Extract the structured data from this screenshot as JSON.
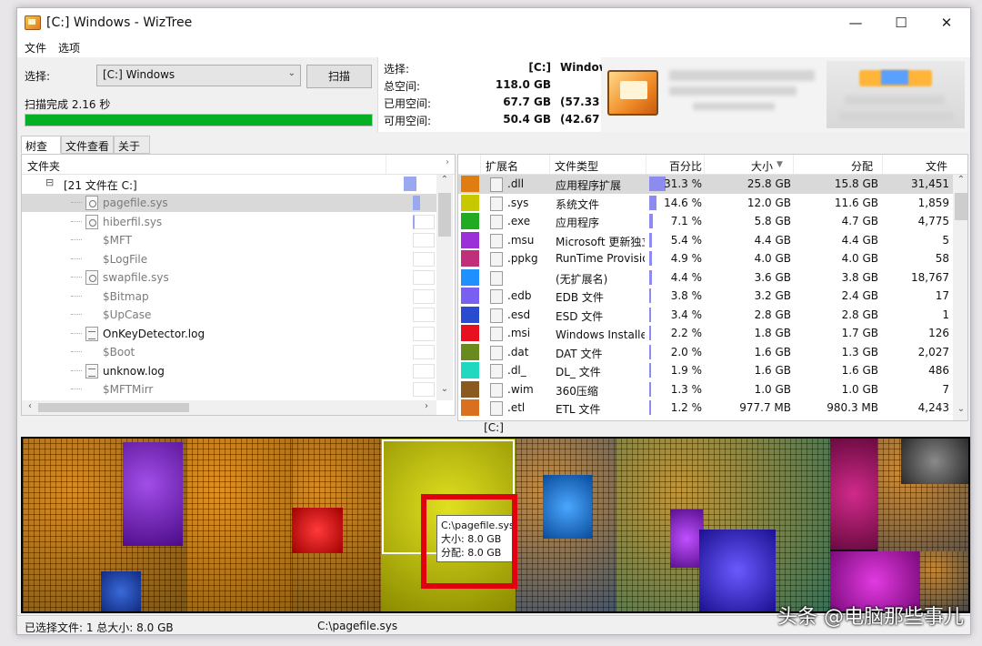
{
  "window": {
    "title": "[C:] Windows  - WizTree",
    "controls": {
      "minimize": "—",
      "maximize": "☐",
      "close": "✕"
    }
  },
  "menu": [
    "文件",
    "选项"
  ],
  "scan": {
    "select_label": "选择:",
    "selected_drive": "[C:] Windows",
    "scan_button": "扫描",
    "status": "扫描完成 2.16 秒",
    "progress_percent": 100
  },
  "space": {
    "rows": [
      {
        "key": "选择:",
        "value": "[C:]",
        "pct": "Window"
      },
      {
        "key": "总空间:",
        "value": "118.0 GB",
        "pct": ""
      },
      {
        "key": "已用空间:",
        "value": "67.7 GB",
        "pct": "(57.33"
      },
      {
        "key": "可用空间:",
        "value": "50.4 GB",
        "pct": "(42.67"
      }
    ]
  },
  "tabs": [
    "树查看",
    "文件查看",
    "关于"
  ],
  "tree": {
    "header": "文件夹",
    "root": "[21 文件在 C:]",
    "items": [
      {
        "name": "pagefile.sys",
        "icon": "gear-file-icon",
        "selected": true,
        "gray": true
      },
      {
        "name": "hiberfil.sys",
        "icon": "gear-file-icon",
        "selected": false,
        "gray": true
      },
      {
        "name": "$MFT",
        "icon": "",
        "selected": false,
        "gray": true
      },
      {
        "name": "$LogFile",
        "icon": "",
        "selected": false,
        "gray": true
      },
      {
        "name": "swapfile.sys",
        "icon": "gear-file-icon",
        "selected": false,
        "gray": true
      },
      {
        "name": "$Bitmap",
        "icon": "",
        "selected": false,
        "gray": true
      },
      {
        "name": "$UpCase",
        "icon": "",
        "selected": false,
        "gray": true
      },
      {
        "name": "OnKeyDetector.log",
        "icon": "log-file-icon",
        "selected": false,
        "gray": false
      },
      {
        "name": "$Boot",
        "icon": "",
        "selected": false,
        "gray": true
      },
      {
        "name": "unknow.log",
        "icon": "log-file-icon",
        "selected": false,
        "gray": false
      },
      {
        "name": "$MFTMirr",
        "icon": "",
        "selected": false,
        "gray": true
      }
    ]
  },
  "extensions": {
    "headers": {
      "ext": "扩展名",
      "type": "文件类型",
      "pct": "百分比",
      "size": "大小",
      "alloc": "分配",
      "files": "文件"
    },
    "rows": [
      {
        "color": "#e07d10",
        "ext": ".dll",
        "type": "应用程序扩展",
        "pct": "31.3 %",
        "pct_value": 31.3,
        "size": "25.8 GB",
        "alloc": "15.8 GB",
        "files": "31,451",
        "selected": true
      },
      {
        "color": "#c6c800",
        "ext": ".sys",
        "type": "系统文件",
        "pct": "14.6 %",
        "pct_value": 14.6,
        "size": "12.0 GB",
        "alloc": "11.6 GB",
        "files": "1,859",
        "selected": false
      },
      {
        "color": "#22aa22",
        "ext": ".exe",
        "type": "应用程序",
        "pct": "7.1 %",
        "pct_value": 7.1,
        "size": "5.8 GB",
        "alloc": "4.7 GB",
        "files": "4,775",
        "selected": false
      },
      {
        "color": "#9b30d9",
        "ext": ".msu",
        "type": "Microsoft 更新独立",
        "pct": "5.4 %",
        "pct_value": 5.4,
        "size": "4.4 GB",
        "alloc": "4.4 GB",
        "files": "5",
        "selected": false
      },
      {
        "color": "#c0307a",
        "ext": ".ppkg",
        "type": "RunTime Provision",
        "pct": "4.9 %",
        "pct_value": 4.9,
        "size": "4.0 GB",
        "alloc": "4.0 GB",
        "files": "58",
        "selected": false
      },
      {
        "color": "#1e90ff",
        "ext": "",
        "type": "(无扩展名)",
        "pct": "4.4 %",
        "pct_value": 4.4,
        "size": "3.6 GB",
        "alloc": "3.8 GB",
        "files": "18,767",
        "selected": false
      },
      {
        "color": "#7a60f0",
        "ext": ".edb",
        "type": "EDB 文件",
        "pct": "3.8 %",
        "pct_value": 3.8,
        "size": "3.2 GB",
        "alloc": "2.4 GB",
        "files": "17",
        "selected": false
      },
      {
        "color": "#2a4ad0",
        "ext": ".esd",
        "type": "ESD 文件",
        "pct": "3.4 %",
        "pct_value": 3.4,
        "size": "2.8 GB",
        "alloc": "2.8 GB",
        "files": "1",
        "selected": false
      },
      {
        "color": "#e8101e",
        "ext": ".msi",
        "type": "Windows Installer 程",
        "pct": "2.2 %",
        "pct_value": 2.2,
        "size": "1.8 GB",
        "alloc": "1.7 GB",
        "files": "126",
        "selected": false
      },
      {
        "color": "#6a8a20",
        "ext": ".dat",
        "type": "DAT 文件",
        "pct": "2.0 %",
        "pct_value": 2.0,
        "size": "1.6 GB",
        "alloc": "1.3 GB",
        "files": "2,027",
        "selected": false
      },
      {
        "color": "#20d8c0",
        "ext": ".dl_",
        "type": "DL_ 文件",
        "pct": "1.9 %",
        "pct_value": 1.9,
        "size": "1.6 GB",
        "alloc": "1.6 GB",
        "files": "486",
        "selected": false
      },
      {
        "color": "#8a5a20",
        "ext": ".wim",
        "type": "360压缩",
        "pct": "1.3 %",
        "pct_value": 1.3,
        "size": "1.0 GB",
        "alloc": "1.0 GB",
        "files": "7",
        "selected": false
      },
      {
        "color": "#d87020",
        "ext": ".etl",
        "type": "ETL 文件",
        "pct": "1.2 %",
        "pct_value": 1.2,
        "size": "977.7 MB",
        "alloc": "980.3 MB",
        "files": "4,243",
        "selected": false
      }
    ]
  },
  "treemap": {
    "label": "[C:]",
    "tooltip": {
      "path": "C:\\pagefile.sys",
      "size": "大小: 8.0 GB",
      "alloc": "分配: 8.0 GB"
    }
  },
  "status": {
    "selected": "已选择文件: 1  总大小: 8.0 GB",
    "path": "C:\\pagefile.sys"
  },
  "watermark": "头条 @电脑那些事儿"
}
